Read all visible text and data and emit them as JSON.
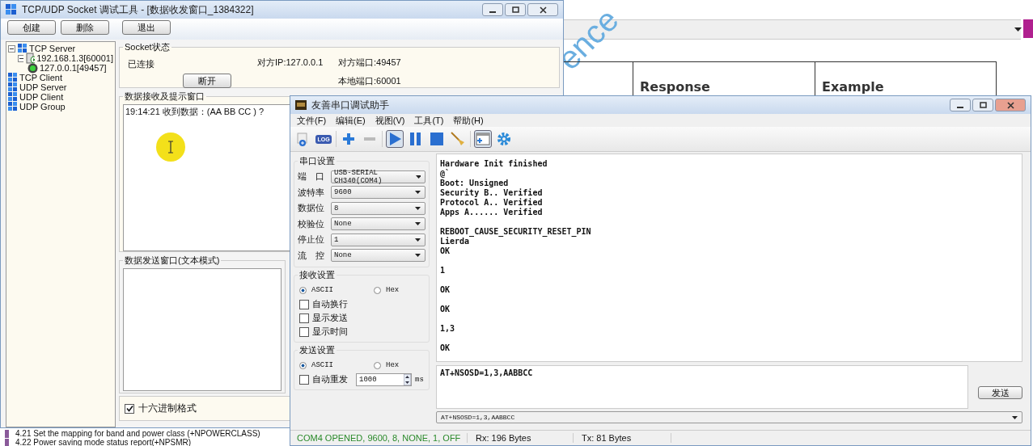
{
  "document": {
    "watermark": "ence",
    "table_headers": [
      "Response",
      "Example"
    ],
    "outline": [
      "4.21 Set the mapping for band and power class (+NPOWERCLASS)",
      "4.22 Power saving mode status report(+NPSMR)"
    ]
  },
  "tcp_window": {
    "title": "TCP/UDP Socket 调试工具 - [数据收发窗口_1384322]",
    "buttons": [
      "创建",
      "删除",
      "退出"
    ],
    "tree": [
      {
        "label": "TCP Server",
        "kind": "group",
        "expanded": true,
        "children": [
          {
            "label": "192.168.1.3[60001]",
            "kind": "server",
            "expanded": true,
            "children": [
              {
                "label": "127.0.0.1[49457]",
                "kind": "client"
              }
            ]
          }
        ]
      },
      {
        "label": "TCP Client",
        "kind": "group"
      },
      {
        "label": "UDP Server",
        "kind": "group"
      },
      {
        "label": "UDP Client",
        "kind": "group"
      },
      {
        "label": "UDP Group",
        "kind": "group"
      }
    ],
    "socket_status": {
      "title": "Socket状态",
      "state": "已连接",
      "peer_ip": "对方IP:127.0.0.1",
      "peer_port": "对方端口:49457",
      "disconnect_button": "断开",
      "local_port": "本地端口:60001"
    },
    "receive": {
      "title": "数据接收及提示窗口",
      "lines": [
        "19:14:21 收到数据：(AA BB CC )  ?"
      ]
    },
    "send": {
      "title": "数据发送窗口(文本模式)",
      "hex_format": {
        "label": "十六进制格式",
        "checked": true
      }
    }
  },
  "serial_window": {
    "title": "友善串口调试助手",
    "menu": [
      "文件(F)",
      "编辑(E)",
      "视图(V)",
      "工具(T)",
      "帮助(H)"
    ],
    "toolbar": [
      {
        "kind": "new",
        "pressed": false
      },
      {
        "kind": "log",
        "label": "LOG",
        "pressed": false
      },
      {
        "kind": "sep"
      },
      {
        "kind": "plus",
        "pressed": false
      },
      {
        "kind": "minus",
        "pressed": false
      },
      {
        "kind": "sep"
      },
      {
        "kind": "play",
        "pressed": true
      },
      {
        "kind": "pause",
        "pressed": false
      },
      {
        "kind": "stop",
        "pressed": false
      },
      {
        "kind": "broom",
        "pressed": false
      },
      {
        "kind": "sep"
      },
      {
        "kind": "window",
        "pressed": true
      },
      {
        "kind": "gear",
        "pressed": false
      }
    ],
    "port_settings": {
      "title": "串口设置",
      "rows": [
        {
          "label": "端　口",
          "value": "USB-SERIAL CH340(COM4)"
        },
        {
          "label": "波特率",
          "value": "9600"
        },
        {
          "label": "数据位",
          "value": "8"
        },
        {
          "label": "校验位",
          "value": "None"
        },
        {
          "label": "停止位",
          "value": "1"
        },
        {
          "label": "流　控",
          "value": "None"
        }
      ]
    },
    "receive_settings": {
      "title": "接收设置",
      "modes": [
        {
          "label": "ASCII",
          "selected": true
        },
        {
          "label": "Hex",
          "selected": false
        }
      ],
      "options": [
        {
          "label": "自动换行",
          "checked": false
        },
        {
          "label": "显示发送",
          "checked": false
        },
        {
          "label": "显示时间",
          "checked": false
        }
      ]
    },
    "send_settings": {
      "title": "发送设置",
      "modes": [
        {
          "label": "ASCII",
          "selected": true
        },
        {
          "label": "Hex",
          "selected": false
        }
      ],
      "auto_resend": {
        "label": "自动重发",
        "checked": false,
        "interval": "1000",
        "unit": "ms"
      }
    },
    "output": [
      {
        "text": "Hardware Init finished",
        "blank_before": false
      },
      {
        "text": "@`",
        "blank_before": false
      },
      {
        "text": "Boot: Unsigned",
        "blank_before": false
      },
      {
        "text": "Security B.. Verified",
        "blank_before": false
      },
      {
        "text": "Protocol A.. Verified",
        "blank_before": false
      },
      {
        "text": "Apps A...... Verified",
        "blank_before": false
      },
      {
        "text": "REBOOT_CAUSE_SECURITY_RESET_PIN",
        "blank_before": true
      },
      {
        "text": "Lierda",
        "blank_before": false
      },
      {
        "text": "OK",
        "blank_before": false
      },
      {
        "text": "1",
        "blank_before": true
      },
      {
        "text": "OK",
        "blank_before": true
      },
      {
        "text": "OK",
        "blank_before": true
      },
      {
        "text": "1,3",
        "blank_before": true
      },
      {
        "text": "OK",
        "blank_before": true
      }
    ],
    "input": "AT+NSOSD=1,3,AABBCC",
    "send_button": "发送",
    "history": "AT+NSOSD=1,3,AABBCC",
    "status": {
      "port": "COM4 OPENED, 9600, 8, NONE, 1, OFF",
      "rx": "Rx: 196 Bytes",
      "tx": "Tx: 81 Bytes"
    }
  }
}
